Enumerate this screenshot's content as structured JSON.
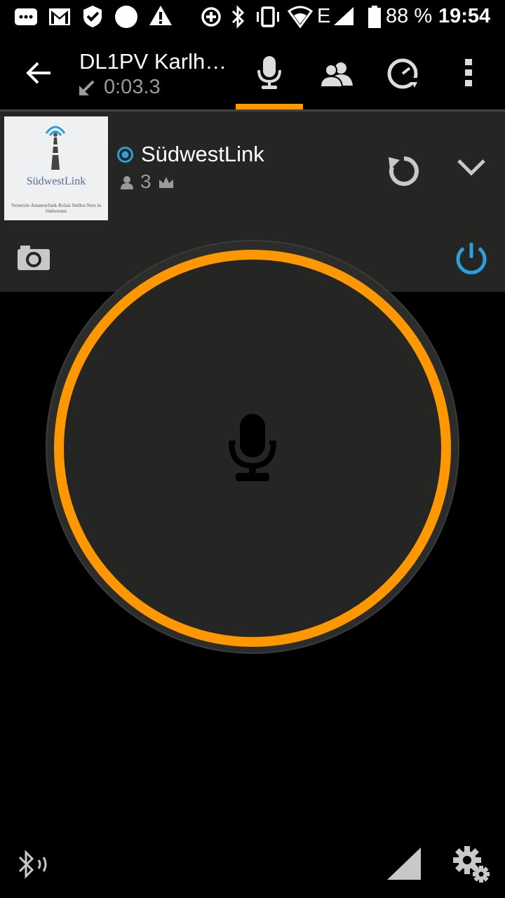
{
  "status_bar": {
    "battery_percent": "88 %",
    "network_type": "E",
    "time": "19:54"
  },
  "toolbar": {
    "contact_title": "DL1PV Karlh…",
    "timer": "0:03.3",
    "active_tab": "microphone"
  },
  "channel": {
    "name": "SüdwestLink",
    "user_count": "3",
    "thumbnail_text": "SüdwestLink",
    "thumbnail_subtext": "Vernetzte Amateurfunk-Relais Stellen Netz in Südwesten"
  },
  "colors": {
    "accent": "#ff9800",
    "power_blue": "#2a9fd8",
    "panel_bg": "#252624"
  }
}
